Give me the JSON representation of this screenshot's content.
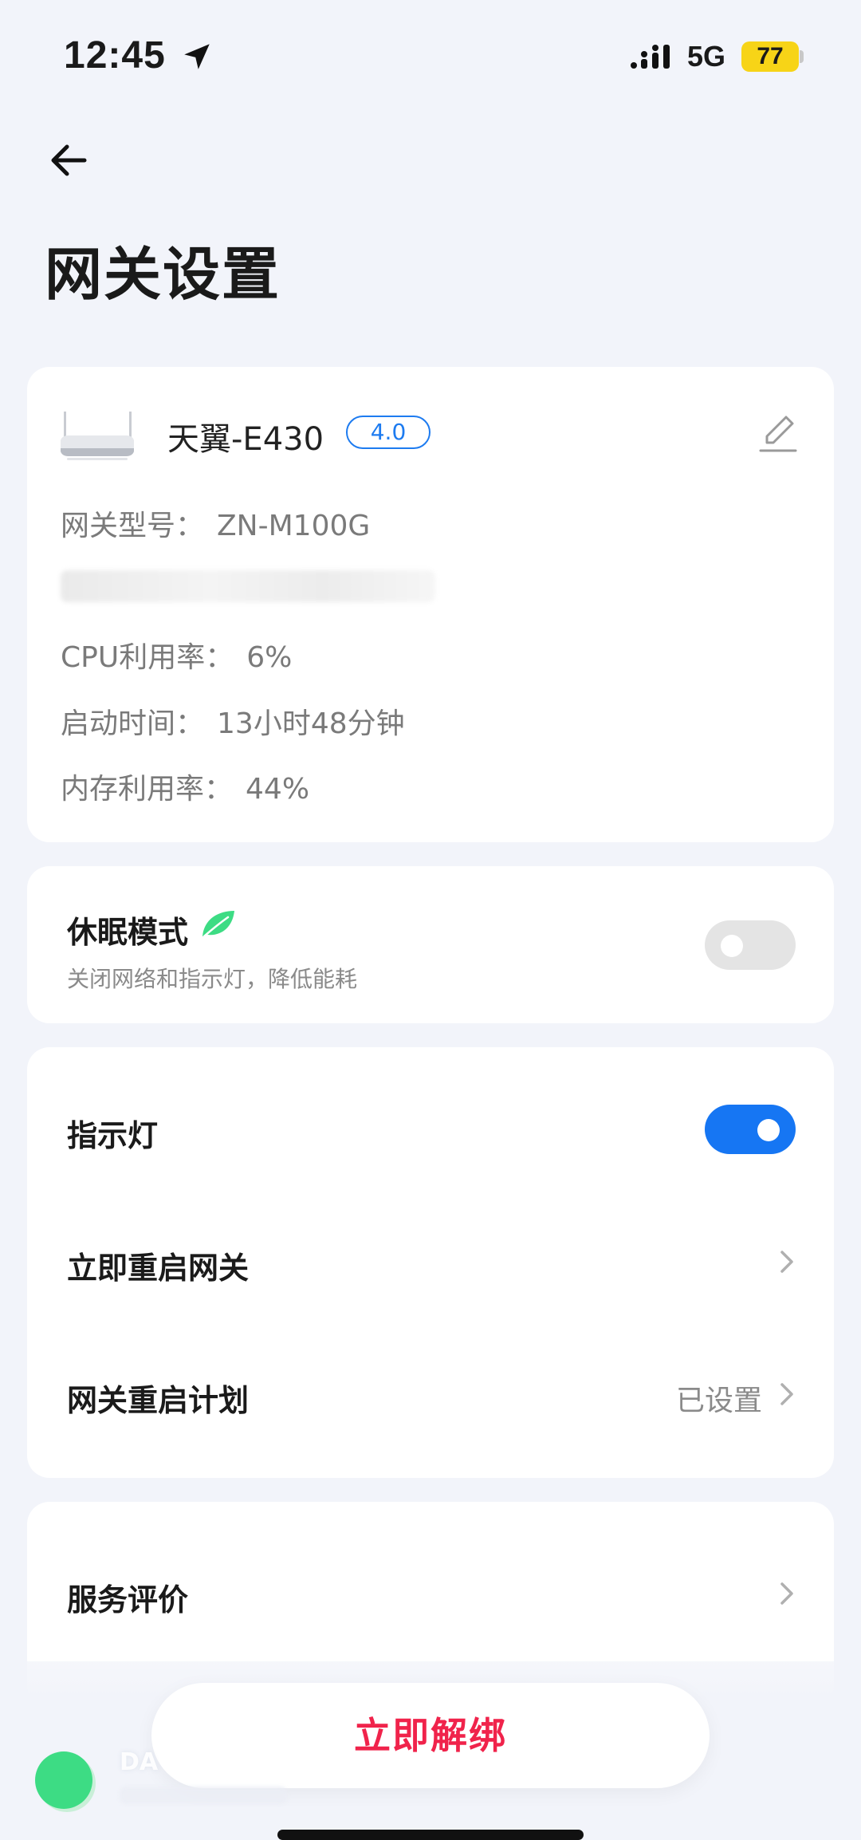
{
  "status_bar": {
    "time": "12:45",
    "network": "5G",
    "battery": "77",
    "battery_color": "#f7d417"
  },
  "header": {
    "back_icon": "arrow-left-icon",
    "title": "网关设置"
  },
  "device": {
    "name": "天翼-E430",
    "version": "4.0",
    "model_label": "网关型号：",
    "model_value": "ZN-M100G",
    "cpu_label": "CPU利用率：",
    "cpu_value": "6%",
    "uptime_label": "启动时间：",
    "uptime_value": "13小时48分钟",
    "memory_label": "内存利用率：",
    "memory_value": "44%"
  },
  "sleep_mode": {
    "title": "休眠模式",
    "description": "关闭网络和指示灯，降低能耗",
    "enabled": false
  },
  "controls": {
    "indicator_label": "指示灯",
    "indicator_enabled": true,
    "reboot_label": "立即重启网关",
    "schedule_label": "网关重启计划",
    "schedule_value": "已设置"
  },
  "service": {
    "label": "服务评价"
  },
  "footer": {
    "unbind_label": "立即解绑",
    "assistant_label": "DA"
  },
  "colors": {
    "accent": "#1676f3",
    "danger": "#f0234b",
    "background": "#f2f4fa",
    "leaf": "#3ddc84"
  }
}
